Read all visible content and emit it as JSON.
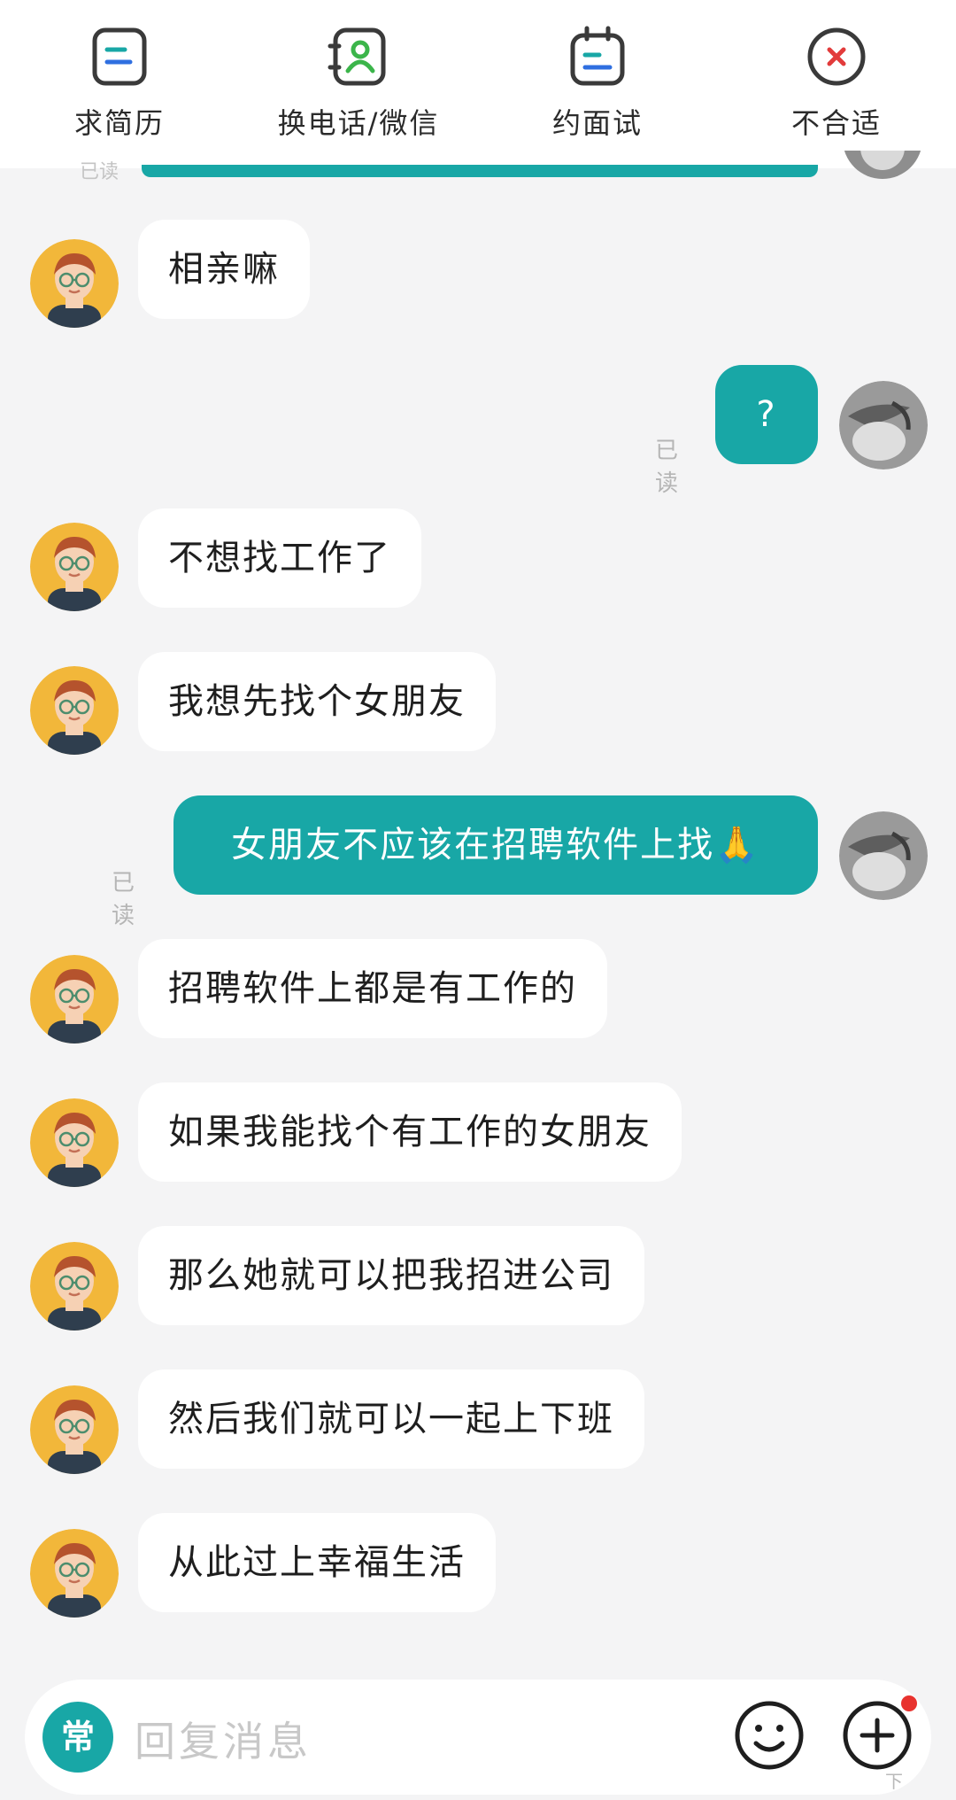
{
  "top_actions": [
    {
      "label": "求简历",
      "icon": "resume-icon"
    },
    {
      "label": "换电话/微信",
      "icon": "contact-exchange-icon"
    },
    {
      "label": "约面试",
      "icon": "calendar-icon"
    },
    {
      "label": "不合适",
      "icon": "close-circle-icon"
    }
  ],
  "chat": {
    "partial_read": "已读",
    "messages": [
      {
        "side": "in",
        "text": "相亲嘛"
      },
      {
        "side": "out",
        "text": "?",
        "read": "已读"
      },
      {
        "side": "in",
        "text": "不想找工作了"
      },
      {
        "side": "in",
        "text": "我想先找个女朋友"
      },
      {
        "side": "out",
        "text": "女朋友不应该在招聘软件上找🙏",
        "read": "已读"
      },
      {
        "side": "in",
        "text": "招聘软件上都是有工作的"
      },
      {
        "side": "in",
        "text": "如果我能找个有工作的女朋友"
      },
      {
        "side": "in",
        "text": "那么她就可以把我招进公司"
      },
      {
        "side": "in",
        "text": "然后我们就可以一起上下班"
      },
      {
        "side": "in",
        "text": "从此过上幸福生活"
      }
    ]
  },
  "composer": {
    "quick_reply_label": "常",
    "placeholder": "回复消息"
  },
  "watermark": "下",
  "colors": {
    "accent": "#18a7a6",
    "background": "#f4f4f5",
    "incoming_bubble": "#ffffff",
    "notification_dot": "#e8322e"
  }
}
